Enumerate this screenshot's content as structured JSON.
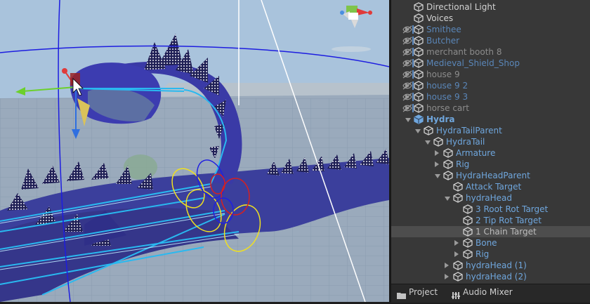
{
  "hierarchy": {
    "items": [
      {
        "label": "Directional Light",
        "depth": 1,
        "foldout": "none",
        "style": "normal",
        "hidden": false
      },
      {
        "label": "Voices",
        "depth": 1,
        "foldout": "none",
        "style": "normal",
        "hidden": false
      },
      {
        "label": "Smithee",
        "depth": 1,
        "foldout": "closed",
        "style": "prefab",
        "hidden": true
      },
      {
        "label": "Butcher",
        "depth": 1,
        "foldout": "closed",
        "style": "prefab",
        "hidden": true
      },
      {
        "label": "merchant booth 8",
        "depth": 1,
        "foldout": "closed",
        "style": "inactive",
        "hidden": true
      },
      {
        "label": "Medieval_Shield_Shop",
        "depth": 1,
        "foldout": "closed",
        "style": "prefab",
        "hidden": true
      },
      {
        "label": "house 9",
        "depth": 1,
        "foldout": "closed",
        "style": "inactive",
        "hidden": true
      },
      {
        "label": "house 9 2",
        "depth": 1,
        "foldout": "closed",
        "style": "prefab",
        "hidden": true
      },
      {
        "label": "house 9 3",
        "depth": 1,
        "foldout": "closed",
        "style": "prefab",
        "hidden": true
      },
      {
        "label": "horse cart",
        "depth": 1,
        "foldout": "closed",
        "style": "inactive",
        "hidden": true
      },
      {
        "label": "Hydra",
        "depth": 1,
        "foldout": "open",
        "style": "prefab-root",
        "hidden": false
      },
      {
        "label": "HydraTailParent",
        "depth": 2,
        "foldout": "open",
        "style": "prefab",
        "hidden": false
      },
      {
        "label": "HydraTail",
        "depth": 3,
        "foldout": "open",
        "style": "prefab",
        "hidden": false
      },
      {
        "label": "Armature",
        "depth": 4,
        "foldout": "closed",
        "style": "prefab",
        "hidden": false
      },
      {
        "label": "Rig",
        "depth": 4,
        "foldout": "closed",
        "style": "prefab",
        "hidden": false
      },
      {
        "label": "HydraHeadParent",
        "depth": 4,
        "foldout": "open",
        "style": "prefab",
        "hidden": false
      },
      {
        "label": "Attack Target",
        "depth": 5,
        "foldout": "none",
        "style": "prefab",
        "hidden": false
      },
      {
        "label": "hydraHead",
        "depth": 5,
        "foldout": "open",
        "style": "prefab",
        "hidden": false
      },
      {
        "label": "3 Root Rot Target",
        "depth": 6,
        "foldout": "none",
        "style": "prefab",
        "hidden": false
      },
      {
        "label": "2 Tip Rot Target",
        "depth": 6,
        "foldout": "none",
        "style": "prefab",
        "hidden": false
      },
      {
        "label": "1 Chain Target",
        "depth": 6,
        "foldout": "none",
        "style": "selected",
        "hidden": false
      },
      {
        "label": "Bone",
        "depth": 6,
        "foldout": "closed",
        "style": "prefab",
        "hidden": false
      },
      {
        "label": "Rig",
        "depth": 6,
        "foldout": "closed",
        "style": "prefab",
        "hidden": false
      },
      {
        "label": "hydraHead (1)",
        "depth": 5,
        "foldout": "closed",
        "style": "prefab",
        "hidden": false
      },
      {
        "label": "hydraHead (2)",
        "depth": 5,
        "foldout": "closed",
        "style": "prefab",
        "hidden": false
      }
    ]
  },
  "tabs": {
    "project": "Project",
    "audio_mixer": "Audio Mixer"
  },
  "colors": {
    "hierarchy_bg": "#383838",
    "prefab_text": "#6fa6dd",
    "selected_row": "#4d4d4d",
    "gizmo_x": "#e03a3a",
    "gizmo_y": "#6cd02c",
    "gizmo_z": "#2f6fe0",
    "bone_line": "#29b9f0"
  }
}
